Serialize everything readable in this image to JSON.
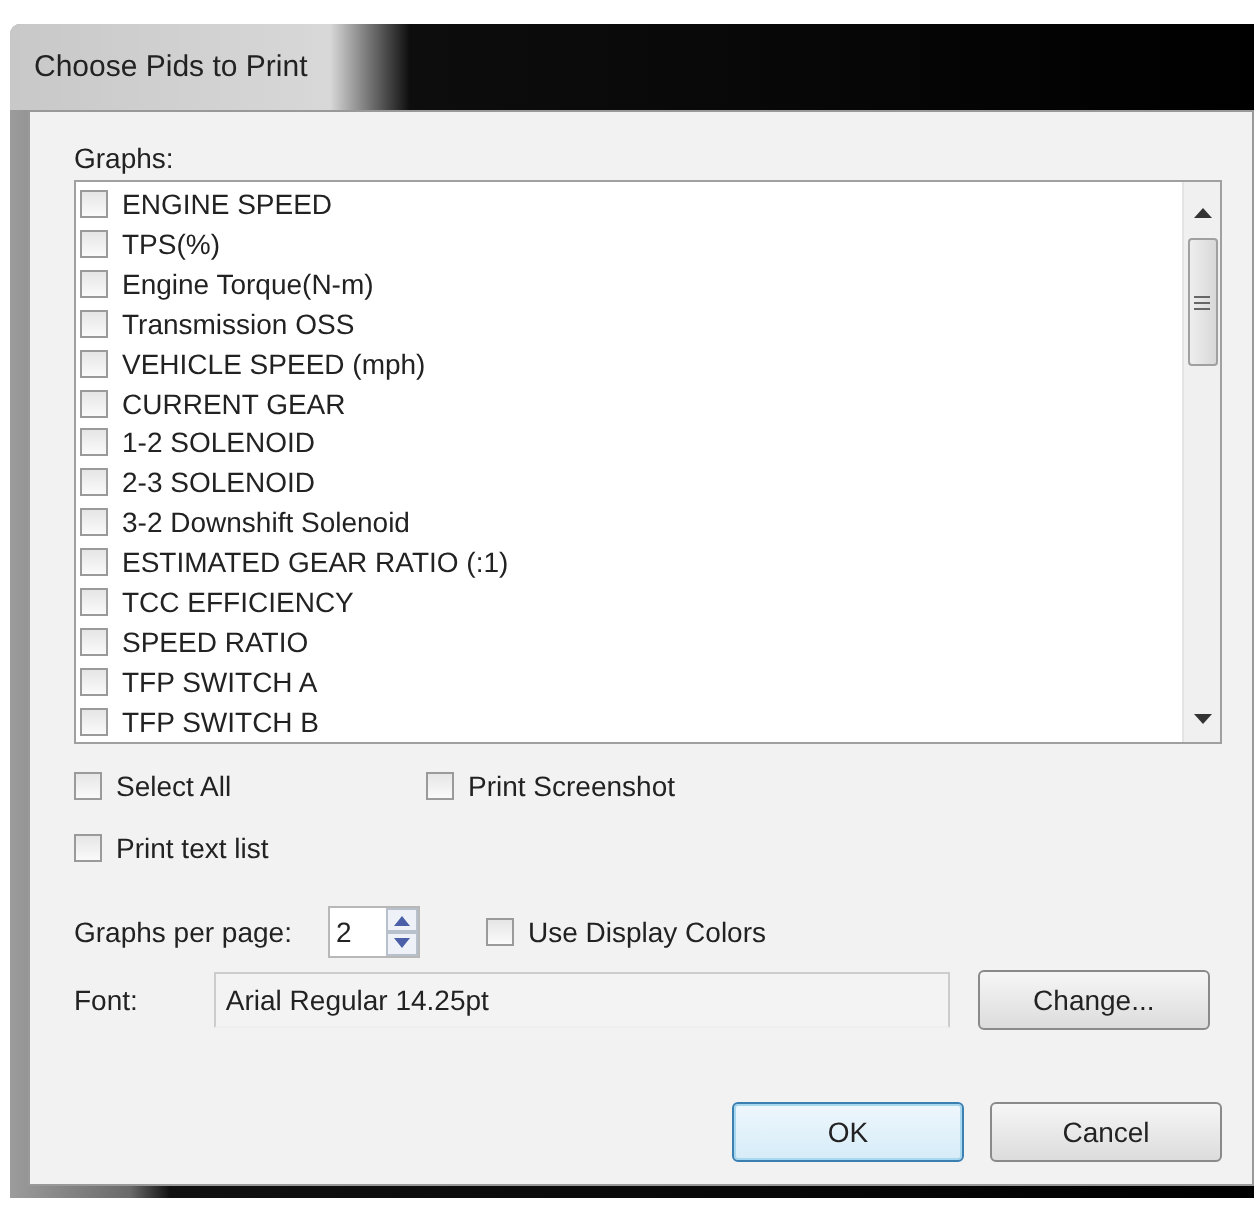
{
  "window": {
    "title": "Choose Pids to Print"
  },
  "graphs": {
    "label": "Graphs:",
    "items": [
      {
        "label": "ENGINE SPEED",
        "checked": false
      },
      {
        "label": "TPS(%)",
        "checked": false
      },
      {
        "label": "Engine Torque(N-m)",
        "checked": false
      },
      {
        "label": "Transmission OSS",
        "checked": false
      },
      {
        "label": "VEHICLE SPEED (mph)",
        "checked": false
      },
      {
        "label": "CURRENT GEAR",
        "checked": false
      },
      {
        "label": "1-2 SOLENOID",
        "checked": false
      },
      {
        "label": "2-3 SOLENOID",
        "checked": false
      },
      {
        "label": "3-2 Downshift Solenoid",
        "checked": false
      },
      {
        "label": "ESTIMATED GEAR RATIO (:1)",
        "checked": false
      },
      {
        "label": "TCC EFFICIENCY",
        "checked": false
      },
      {
        "label": "SPEED RATIO",
        "checked": false
      },
      {
        "label": "TFP SWITCH A",
        "checked": false
      },
      {
        "label": "TFP SWITCH B",
        "checked": false
      }
    ]
  },
  "options": {
    "select_all": {
      "label": "Select All",
      "checked": false
    },
    "print_screenshot": {
      "label": "Print Screenshot",
      "checked": false
    },
    "print_text_list": {
      "label": "Print text list",
      "checked": false
    }
  },
  "graphs_per_page": {
    "label": "Graphs per page:",
    "value": "2"
  },
  "use_display_colors": {
    "label": "Use Display Colors",
    "checked": false
  },
  "font": {
    "label": "Font:",
    "value": "Arial Regular 14.25pt",
    "button": "Change..."
  },
  "buttons": [
    {
      "label": "OK",
      "default": true
    },
    {
      "label": "Cancel",
      "default": false
    }
  ]
}
